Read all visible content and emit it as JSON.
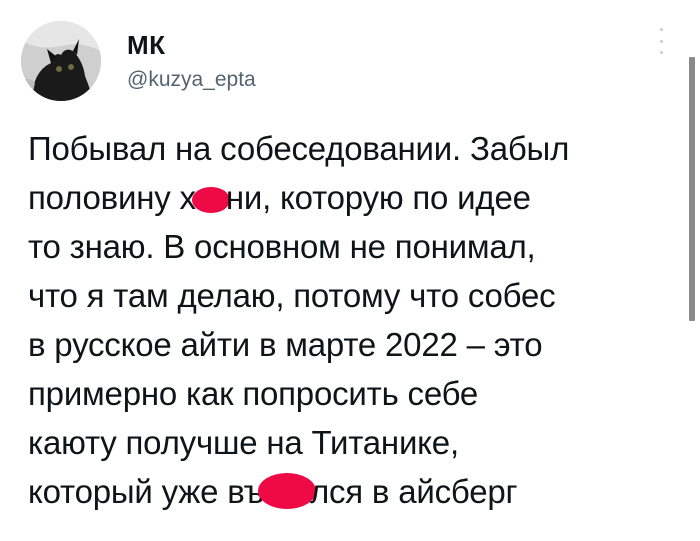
{
  "user": {
    "display_name": "МК",
    "handle": "@kuzya_epta"
  },
  "tweet": {
    "lines": [
      "Побывал на собеседовании. Забыл",
      "половину х",
      "ни, которую по идее",
      "то знаю. В основном не понимал,",
      "что я там делаю, потому что собес",
      "в русское айти в марте 2022 – это",
      "примерно как попросить себе",
      "каюту получше на Титанике,",
      "который уже въ",
      "лся в айсберг"
    ]
  },
  "colors": {
    "redaction": "#ee0a45",
    "text": "#0f1419",
    "secondary_text": "#536471"
  },
  "icons": {
    "more": "vertical-ellipsis-icon"
  }
}
